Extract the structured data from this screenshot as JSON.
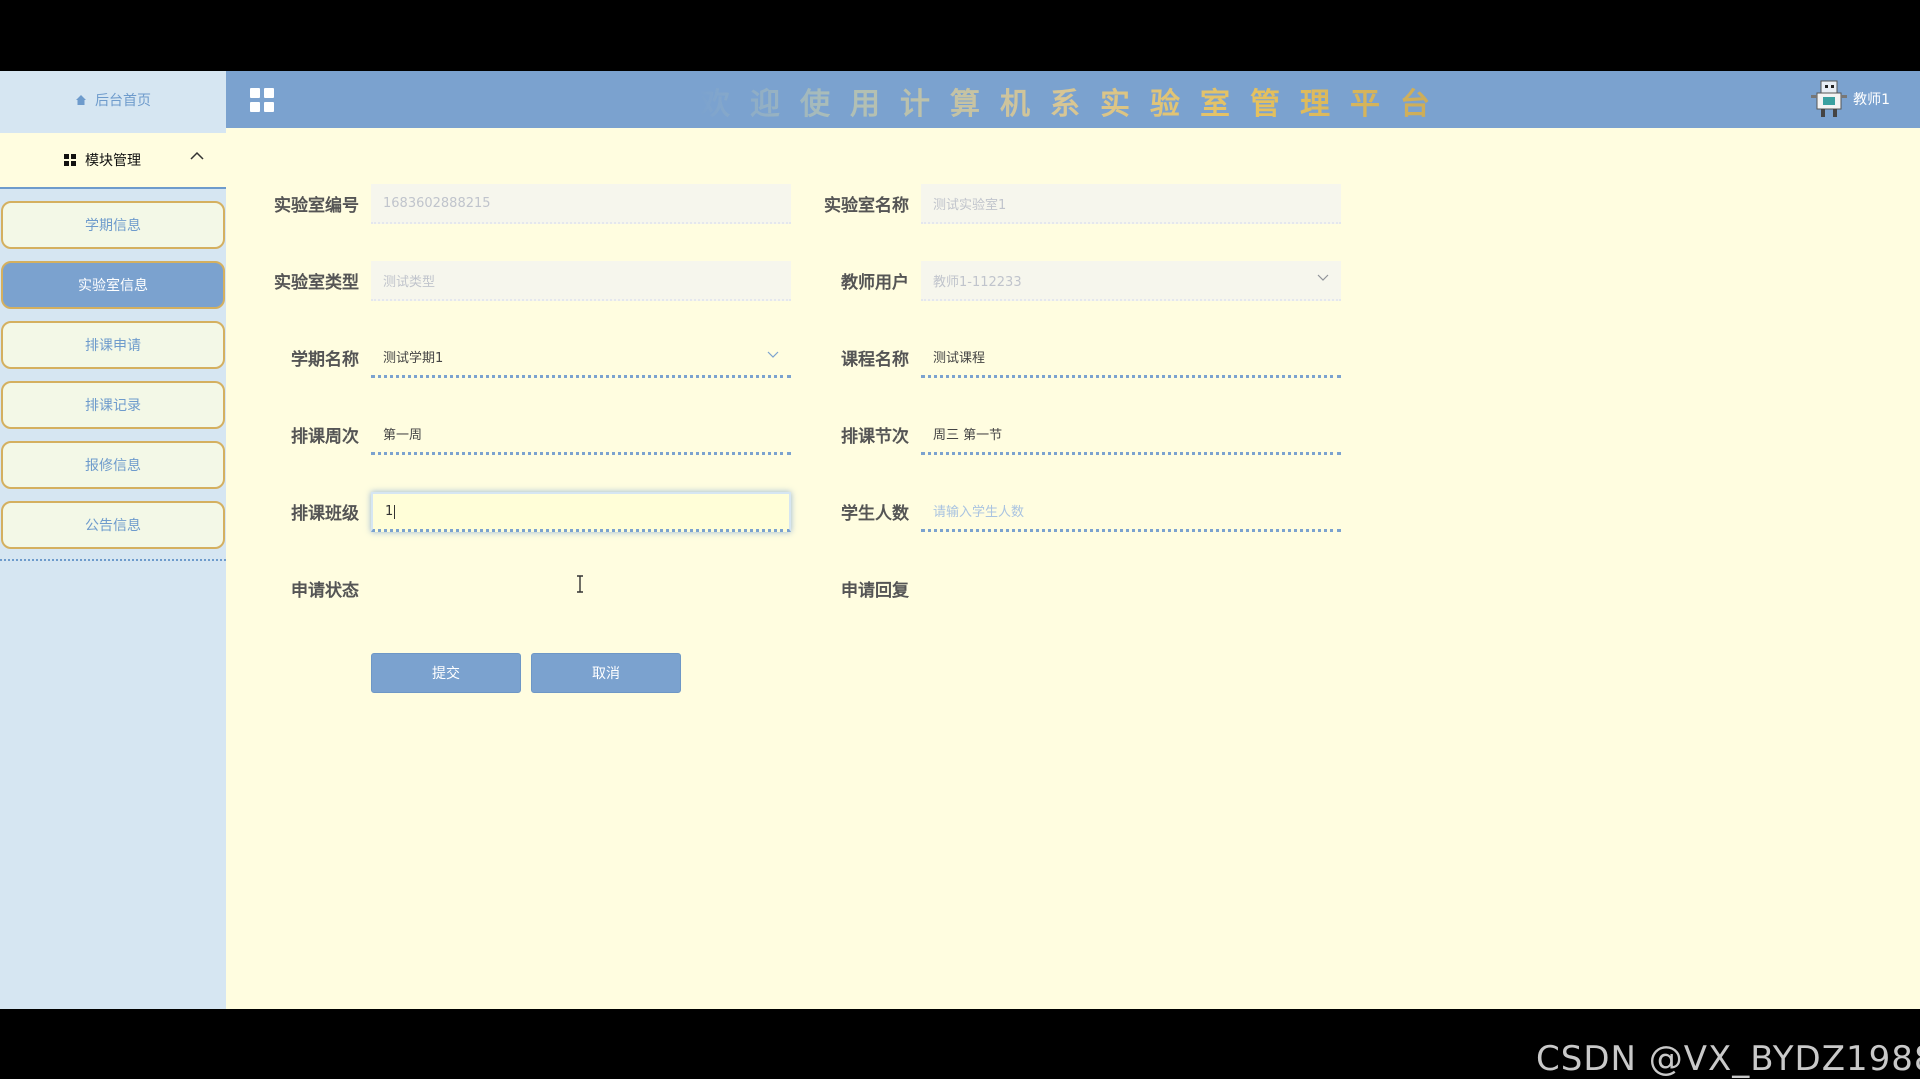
{
  "header": {
    "title": "欢迎使用计算机系实验室管理平台",
    "user_name": "教师1"
  },
  "sidebar": {
    "home": "后台首页",
    "module": "模块管理",
    "items": [
      {
        "label": "学期信息",
        "active": false
      },
      {
        "label": "实验室信息",
        "active": true
      },
      {
        "label": "排课申请",
        "active": false
      },
      {
        "label": "排课记录",
        "active": false
      },
      {
        "label": "报修信息",
        "active": false
      },
      {
        "label": "公告信息",
        "active": false
      }
    ]
  },
  "form": {
    "lab_id": {
      "label": "实验室编号",
      "value": "1683602888215"
    },
    "lab_name": {
      "label": "实验室名称",
      "value": "测试实验室1"
    },
    "lab_type": {
      "label": "实验室类型",
      "value": "测试类型"
    },
    "teacher_user": {
      "label": "教师用户",
      "value": "教师1-112233"
    },
    "term_name": {
      "label": "学期名称",
      "value": "测试学期1"
    },
    "course_name": {
      "label": "课程名称",
      "value": "测试课程"
    },
    "week": {
      "label": "排课周次",
      "value": "第一周"
    },
    "section": {
      "label": "排课节次",
      "value": "周三 第一节"
    },
    "class": {
      "label": "排课班级",
      "value": "1"
    },
    "student_count": {
      "label": "学生人数",
      "placeholder": "请输入学生人数"
    },
    "apply_status": {
      "label": "申请状态"
    },
    "apply_reply": {
      "label": "申请回复"
    }
  },
  "buttons": {
    "submit": "提交",
    "cancel": "取消"
  },
  "watermark": "CSDN @VX_BYDZ1988",
  "colors": {
    "accent": "#7ba2cf",
    "background": "#fffde0",
    "sidebar": "#d6e6f2",
    "border_gold": "#d4b060"
  }
}
